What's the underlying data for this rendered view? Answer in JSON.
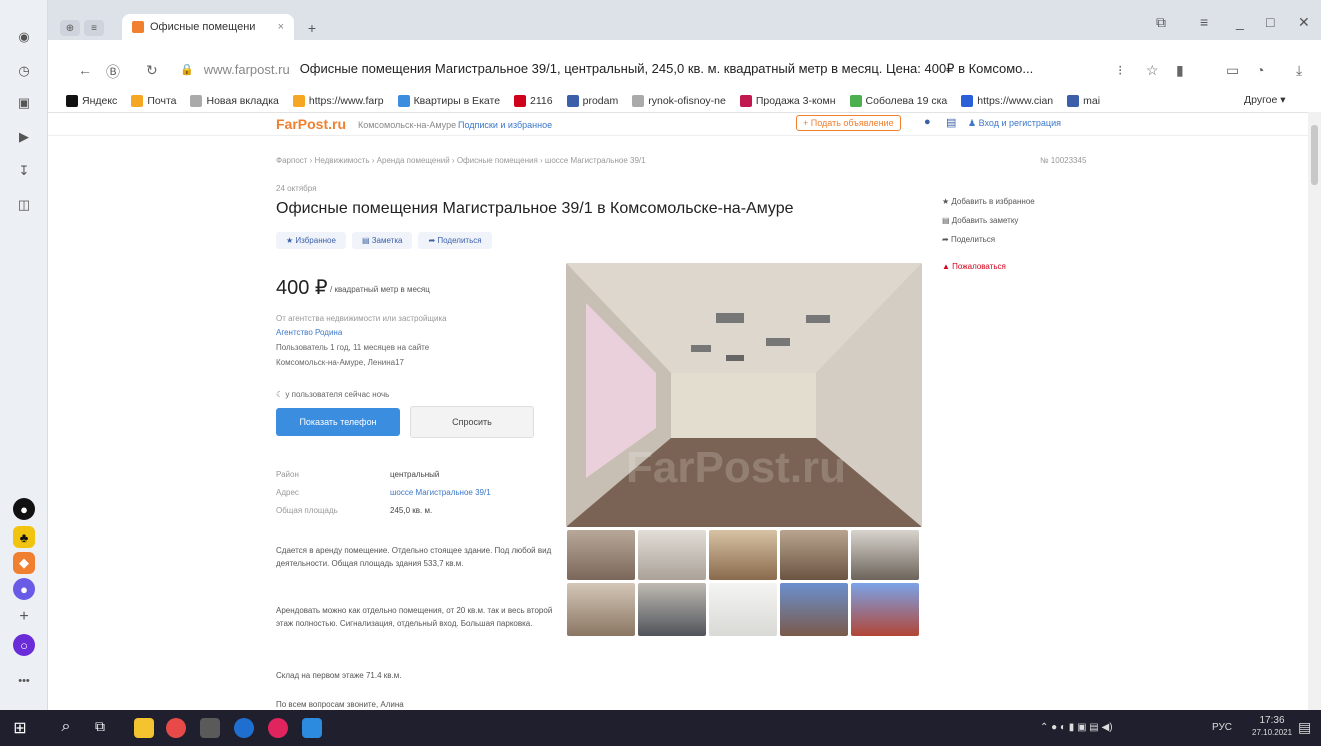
{
  "browser": {
    "tab_title": "Офисные помещени",
    "new_tab": "+",
    "address_host": "www.farpost.ru",
    "address_title": "Офисные помещения Магистральное 39/1, центральный, 245,0 кв. м. квадратный метр в месяц. Цена: 400₽ в Комсомо...",
    "bookmarks": [
      {
        "label": "Яндекс",
        "color": "#111"
      },
      {
        "label": "Почта",
        "color": "#f5a623"
      },
      {
        "label": "Новая вкладка",
        "color": "#aaa"
      },
      {
        "label": "https://www.farp",
        "color": "#f5a623"
      },
      {
        "label": "Квартиры в Екате",
        "color": "#3b8de0"
      },
      {
        "label": "2116",
        "color": "#d0021b"
      },
      {
        "label": "prodam",
        "color": "#3b5fa8"
      },
      {
        "label": "rynok-ofisnoy-ne",
        "color": "#aaa"
      },
      {
        "label": "Продажа 3-комн",
        "color": "#c0184f"
      },
      {
        "label": "Соболева 19 ска",
        "color": "#4caf50"
      },
      {
        "label": "https://www.cian",
        "color": "#2a5fd8"
      },
      {
        "label": "mai",
        "color": "#3b5fa8"
      }
    ],
    "bookmarks_other": "Другое"
  },
  "site": {
    "logo": "FarPost.ru",
    "city": "Комсомольск-на-Амуре",
    "favorites_link": "Подписки и избранное",
    "post_ad": "+ Подать объявление",
    "login": "Вход и регистрация"
  },
  "listing": {
    "breadcrumb": "Фарпост › Недвижимость › Аренда помещений › Офисные помещения › шоссе Магистральное 39/1",
    "ad_number": "№ 10023345",
    "date": "24 октября",
    "title": "Офисные помещения Магистральное 39/1 в Комсомольске-на-Амуре",
    "actions": [
      "★ Избранное",
      "▤ Заметка",
      "➦ Поделиться"
    ],
    "price": "400 ₽",
    "price_unit": "/ квадратный метр в месяц",
    "seller_type": "От агентства недвижимости или застройщика",
    "seller_name": "Агентство Родина",
    "seller_since": "Пользователь 1 год, 11 месяцев на сайте",
    "seller_address": "Комсомольск-на-Амуре, Ленина17",
    "online": "у пользователя сейчас ночь",
    "show_phone": "Показать телефон",
    "ask": "Спросить",
    "props": [
      {
        "label": "Район",
        "value": "центральный"
      },
      {
        "label": "Адрес",
        "value": "шоссе Магистральное 39/1"
      },
      {
        "label": "Общая площадь",
        "value": "245,0 кв. м."
      }
    ],
    "desc1": "Сдается в аренду помещение. Отдельно стоящее здание. Под любой вид деятельности. Общая площадь здания 533,7 кв.м.",
    "desc2": "Арендовать можно как отдельно помещения, от 20 кв.м. так и весь второй этаж полностью. Сигнализация, отдельный вход. Большая парковка.",
    "desc3": "Склад на первом этаже 71.4 кв.м.",
    "desc4": "По всем вопросам звоните, Алина",
    "watermark": "FarPost.ru"
  },
  "sidebar": {
    "items": [
      "Добавить в избранное",
      "Добавить заметку",
      "Поделиться"
    ],
    "report": "Пожаловаться"
  },
  "taskbar": {
    "lang": "РУС",
    "time": "17:36",
    "date": "27.10.2021"
  }
}
